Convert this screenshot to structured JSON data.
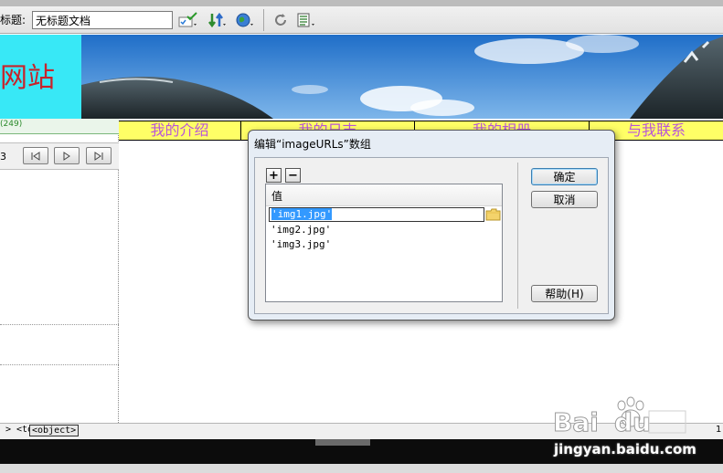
{
  "toolbar": {
    "title_label": "标题:",
    "title_value": "无标题文档",
    "icons": [
      "validate-icon",
      "file-transfer-icon",
      "browser-preview-icon",
      "refresh-icon",
      "view-options-icon"
    ]
  },
  "design": {
    "banner_title": "网站",
    "ruler_text": "(249)",
    "media_counter": "3",
    "nav_items": [
      "我的介绍",
      "我的日志",
      "我的相册",
      "与我联系"
    ]
  },
  "status": {
    "tag_td": "> <td>",
    "tag_object": "<object>",
    "page_num": "1"
  },
  "dialog": {
    "title": "编辑“imageURLs”数组",
    "add_label": "+",
    "remove_label": "−",
    "column_header": "值",
    "editing_value": "'img1.jpg'",
    "rows": [
      "'img2.jpg'",
      "'img3.jpg'"
    ],
    "ok_label": "确定",
    "cancel_label": "取消",
    "help_label": "帮助(H)"
  },
  "watermark": {
    "text": "jingyan.baidu.com"
  },
  "colors": {
    "banner_cyan": "#38e8f6",
    "nav_yellow": "#ffff66",
    "nav_text": "#b855d8",
    "title_red": "#c8242b",
    "selection_blue": "#3399ff"
  }
}
